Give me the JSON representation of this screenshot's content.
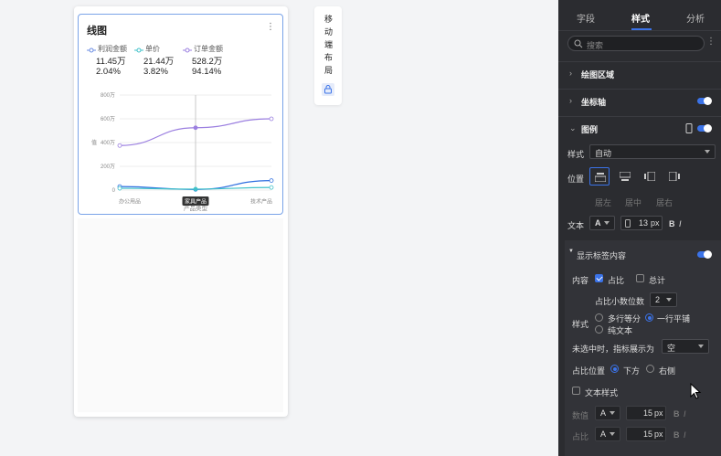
{
  "card": {
    "title": "线图",
    "legend": [
      {
        "name": "利润金额",
        "amount": "11.45万",
        "ratio": "2.04%",
        "color": "#6b8de3"
      },
      {
        "name": "单价",
        "amount": "21.44万",
        "ratio": "3.82%",
        "color": "#3fc1c9"
      },
      {
        "name": "订单金额",
        "amount": "528.2万",
        "ratio": "94.14%",
        "color": "#9b7fe0"
      }
    ]
  },
  "chart_data": {
    "type": "line",
    "categories": [
      "办公用品",
      "家具产品",
      "技术产品"
    ],
    "xlabel": "产品类型",
    "ylabel": "值",
    "y_ticks": [
      "0",
      "200万",
      "400万",
      "600万",
      "800万"
    ],
    "ylim": [
      0,
      800
    ],
    "highlighted_category": "家具产品",
    "series": [
      {
        "name": "订单金额",
        "values": [
          375,
          525,
          600
        ],
        "color": "#9b7fe0"
      },
      {
        "name": "利润金额",
        "values": [
          30,
          5,
          80
        ],
        "color": "#2f6fe0"
      },
      {
        "name": "单价",
        "values": [
          15,
          8,
          22
        ],
        "color": "#3fc1c9"
      }
    ]
  },
  "mobile": {
    "label": "移动端布局"
  },
  "panel": {
    "tabs": [
      "字段",
      "样式",
      "分析"
    ],
    "search_placeholder": "搜索",
    "sections": {
      "plot_area": "绘图区域",
      "axis": "坐标轴",
      "legend": "图例"
    },
    "legend": {
      "style_label": "样式",
      "style_value": "自动",
      "position_label": "位置",
      "align_options": [
        "居左",
        "居中",
        "居右"
      ],
      "text_label": "文本",
      "font_size": "13",
      "font_unit": "px",
      "bold": "B",
      "italic": "I"
    },
    "show_label": {
      "title": "显示标签内容",
      "content_label": "内容",
      "ratio_option": "占比",
      "total_option": "总计",
      "decimal_label": "占比小数位数",
      "decimal_value": "2",
      "style_label": "样式",
      "style_opt1": "多行等分",
      "style_opt2": "一行平铺",
      "style_opt3": "纯文本",
      "unselected_label": "未选中时，指标展示为",
      "unselected_value": "空",
      "ratio_pos_label": "占比位置",
      "ratio_pos_opt1": "下方",
      "ratio_pos_opt2": "右侧",
      "text_style_label": "文本样式",
      "value_label": "数值",
      "ratio_label": "占比",
      "dim_font_size": "15",
      "dim_unit": "px"
    }
  }
}
